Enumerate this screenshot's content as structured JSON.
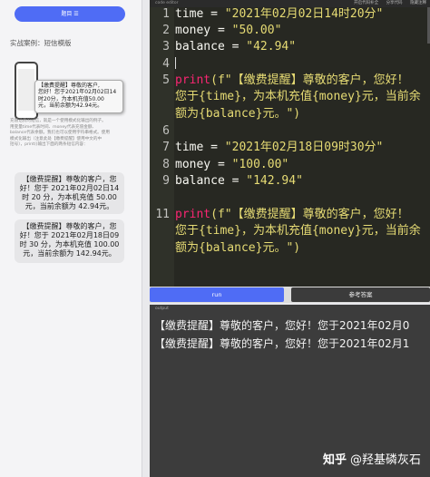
{
  "left": {
    "menu_label": "题目 ☰",
    "case_title": "实战案例：短信模版",
    "phone_card": [
      "【缴费提醒】尊敬的客户,",
      "您好！您于2021年02月02日14",
      "时20分，为本机充值50.00",
      "元，当前余额为42.94元。"
    ],
    "desc_lines": [
      "充值话费的短信，就是一个使用模式化输出的例子。",
      "用变量time代表时间、money代表充值金额、",
      "balance代表余额。我们也可以使用字符串格式。使用",
      "模式化输出（注意此处【缴费提醒】使用中文的中",
      "括号），print()输出下面的两条短信内容："
    ],
    "desc_hl": "中文的中括号",
    "bubble1": [
      "【缴费提醒】尊敬的客户，您",
      "好！您于 2021年02月02日14",
      "时 20 分，为本机充值 50.00",
      "元，当前余额为 42.94元。"
    ],
    "bubble2": [
      "【缴费提醒】尊敬的客户，您",
      "好！您于 2021年02月18日09",
      "时 30 分，为本机充值 100.00",
      "元，当前余额为 142.94元。"
    ]
  },
  "editor": {
    "title": "code editor",
    "actions": [
      "开启代码补全",
      "分享代码",
      "隐藏注释"
    ],
    "line_numbers": [
      "1",
      "2",
      "3",
      "4",
      "5",
      "",
      "",
      "6",
      "7",
      "8",
      "9",
      "10",
      "11"
    ],
    "lines": {
      "l1_var": "time = ",
      "l1_str": "\"2021年02月02日14时20分\"",
      "l2_var": "money = ",
      "l2_str": "\"50.00\"",
      "l3_var": "balance = ",
      "l3_str": "\"42.94\"",
      "l5_kw": "print",
      "l5_rest": "(f\"【缴费提醒】尊敬的客户，您好！",
      "l5b": "您于{time}，为本机充值{money}元，当前余",
      "l5c": "额为{balance}元。\")",
      "l7_var": "time = ",
      "l7_str": "\"2021年02月18日09时30分\"",
      "l8_var": "money = ",
      "l8_str": "\"100.00\"",
      "l9_var": "balance = ",
      "l9_str": "\"142.94\"",
      "l11_kw": "print",
      "l11_rest": "(f\"【缴费提醒】尊敬的客户，您好！",
      "l11b": "您于{time}，为本机充值{money}元，当前余",
      "l11c": "额为{balance}元。\")"
    }
  },
  "buttons": {
    "run": "run",
    "answer": "参考答案"
  },
  "output": {
    "label": "output",
    "lines": [
      "【缴费提醒】尊敬的客户，您好！您于2021年02月0",
      "【缴费提醒】尊敬的客户，您好！您于2021年02月1"
    ],
    "watermark_site": "知乎",
    "watermark_user": "@羟基磷灰石"
  }
}
